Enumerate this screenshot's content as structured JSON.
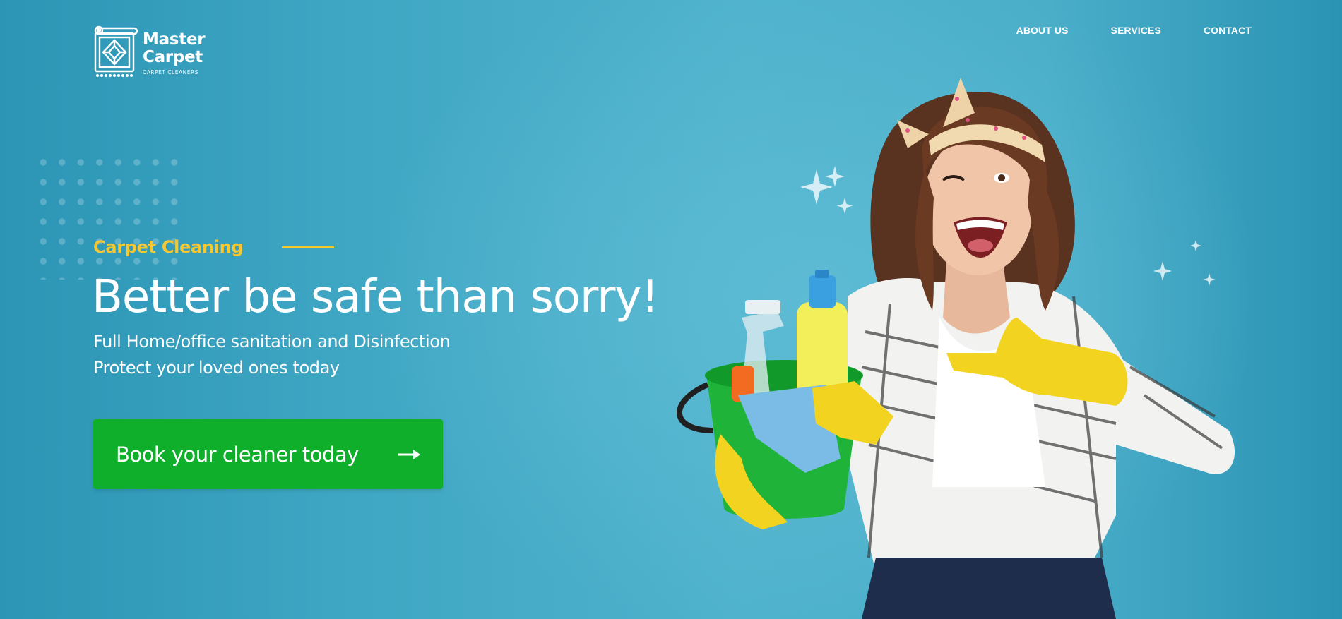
{
  "header": {
    "logo": {
      "title_line1": "Master",
      "title_line2": "Carpet",
      "subtitle": "CARPET CLEANERS",
      "icon": "carpet-icon"
    },
    "nav": [
      {
        "label": "ABOUT US"
      },
      {
        "label": "SERVICES"
      },
      {
        "label": "CONTACT"
      }
    ]
  },
  "hero": {
    "eyebrow": "Carpet Cleaning",
    "headline": "Better be safe than sorry!",
    "subline1": "Full Home/office sanitation and Disinfection",
    "subline2": "Protect your loved ones today",
    "cta": {
      "label": "Book your cleaner today",
      "icon": "arrow-right-icon"
    },
    "image": {
      "subject": "woman-with-cleaning-supplies"
    }
  },
  "colors": {
    "background": "#4aaec9",
    "accent_yellow": "#f5c731",
    "cta_green": "#0faf2c",
    "text": "#ffffff"
  }
}
